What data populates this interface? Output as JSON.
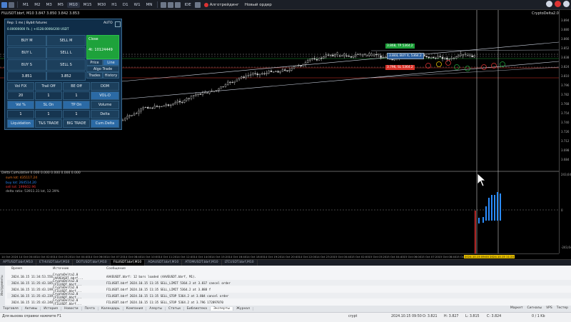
{
  "toolbar": {
    "symbol": "FILUSDT.bbrf",
    "timeframes": [
      "M1",
      "M2",
      "M3",
      "M5",
      "M10",
      "M15",
      "M30",
      "H1",
      "D1",
      "W1",
      "MN"
    ],
    "active_timeframe": "M10",
    "algo_label": "Алготрейдинг",
    "new_order_label": "Новый ордер",
    "ide_label": "IDE"
  },
  "chart": {
    "symbol_label": "FILUSDT.bbrf, M10  3.847 3.850 3.842 3.853",
    "indicator_name": "CryptoDelta2.0",
    "price_ticks": [
      "3.894",
      "3.880",
      "3.866",
      "3.852",
      "3.838",
      "3.824",
      "3.810",
      "3.796",
      "3.782",
      "3.768",
      "3.754",
      "3.740",
      "3.726",
      "3.712",
      "3.698",
      "3.684"
    ],
    "lower_ticks": [
      "243,649",
      "0",
      "-243,649"
    ],
    "order_labels": {
      "tp": "3.868, TP 5364.2",
      "entry": "3.844, BUY lt, 5364.2",
      "sl": "3.796, SL 5364.2"
    },
    "time_ticks": [
      "14 Oct 2024",
      "14 Oct 00:40",
      "14 Oct 02:00",
      "14 Oct 03:20",
      "14 Oct 04:40",
      "14 Oct 06:00",
      "14 Oct 07:20",
      "14 Oct 08:40",
      "14 Oct 10:00",
      "14 Oct 11:20",
      "14 Oct 12:40",
      "14 Oct 14:00",
      "14 Oct 15:20",
      "14 Oct 16:40",
      "14 Oct 18:00",
      "14 Oct 19:20",
      "14 Oct 20:40",
      "14 Oct 22:00",
      "14 Oct 23:20",
      "15 Oct 00:40",
      "15 Oct 02:00",
      "15 Oct 03:20",
      "15 Oct 04:40",
      "15 Oct 06:00",
      "15 Oct 07:20",
      "15 Oct 08:40",
      "15 Oct 10:00"
    ],
    "time_highlight": "2024.10.15 09:00  2024.10.15 11:20"
  },
  "panel": {
    "header": "Rep: 1 ms | Bybit futures",
    "subheader": "0.00000000 Fk. | +4128.00064200 USDT",
    "auto_label": "AUTO",
    "buy_m": "BUY M",
    "sell_m": "SELL M",
    "buy_l": "BUY L",
    "sell_l": "SELL L",
    "buy_s": "BUY S",
    "sell_s": "SELL S",
    "bid": "3.851",
    "ask": "3.852",
    "close_label": "Close",
    "close_value": "4t: 10124449",
    "price": "Price",
    "line": "Line",
    "algo_trade": "Algo Trade",
    "trades": "Trades",
    "history": "History",
    "vol_fix": "Vol FIX",
    "trail_off": "Trail Off",
    "be_off": "BE Off",
    "dom": "DOM",
    "val_20": "20",
    "val_1a": "1",
    "val_1b": "1",
    "vol_d": "VOL-D",
    "vol_pct": "Vol %",
    "sl_on": "SL On",
    "tp_on": "TP On",
    "volume": "Volume",
    "val_1c": "1",
    "val_1d": "1",
    "val_1e": "1",
    "delta": "Delta",
    "liquidation": "Liquidation",
    "ts_trade": "T&S TRADE",
    "big_trade": "BIG TRADE",
    "cum_delta": "Cum.Delta"
  },
  "indicator": {
    "title": "Delta Cumulative 0.000 0.000 0.000 0.000 0.000",
    "sum_lot": "sum lot: 435117.24",
    "buy_lot": "buy lot: 264514.20",
    "sell_lot": "sell lot: 199602.96",
    "delta_ratio": "delta ratio: 53911.31 lot, 12.39%"
  },
  "symbol_tabs": [
    "APTUSDT.bbrf,M10",
    "ETHUSDT.bbrf,M10",
    "DOTUSDT.bbrf,M10",
    "FILUSDT.bbrf,M10",
    "ADAUSDT.bbrf,M10",
    "ATOMUSDT.bbrf,M10",
    "LTCUSDT.bbrf,M10"
  ],
  "active_symbol_tab": "FILUSDT.bbrf,M10",
  "log": {
    "columns": [
      "Время",
      "Источник",
      "Сообщение"
    ],
    "side_label": "Инструменты",
    "rows": [
      {
        "time": "2024.10.15 11:34:53.556",
        "src": "CryptoDelta2.0 (AAVEUSDT.bbrf...",
        "msg": "AAVEUSDT.bbrf: 12 bars loaded (AAVEUSDT.bbrf, M1)."
      },
      {
        "time": "2024.10.15 11:35:43.185",
        "src": "CryptoDelta2.0 (FILUSDT.bbrf...",
        "msg": "FILUSDT.bbrf 2024.10.15 11:35 SELL_LIMIT 5364.2 at 3.837 cancel order"
      },
      {
        "time": "2024.10.15 11:35:43.199",
        "src": "CryptoDelta2.0 (FILUSDT.bbrf...",
        "msg": "FILUSDT.bbrf 2024.10.15 11:35 SELL_LIMIT 5364.2 at 3.888 f"
      },
      {
        "time": "2024.10.15 11:35:43.239",
        "src": "CryptoDelta2.0 (FILUSDT.bbrf...",
        "msg": "FILUSDT.bbrf 2024.10.15 11:35 SELL_STOP 5364.2 at 3.804 cancel order"
      },
      {
        "time": "2024.10.15 11:35:43.248",
        "src": "CryptoDelta2.0 (FILUSDT.bbrf...",
        "msg": "FILUSDT.bbrf 2024.10.15 11:35 SELL_STOP 5364.2 at 3.796 172897870"
      }
    ],
    "tabs": [
      "Торговля",
      "Активы",
      "История",
      "Новости",
      "Почта",
      "Календарь",
      "Компания",
      "Алерты",
      "Статьи",
      "Библиотека",
      "Эксперты",
      "Журнал"
    ],
    "active_tab": "Эксперты",
    "right_items": [
      "Маркет",
      "Сигналы",
      "VPS",
      "Тестер"
    ]
  },
  "status": {
    "help": "Для вызова справки нажмите F1",
    "profile": "crypt",
    "datetime": "2024.10.15 09:50",
    "open": "O: 3.821",
    "high": "H: 3.827",
    "low": "L: 3.815",
    "close": "C: 3.824",
    "traffic": "0 / 1 Kb"
  },
  "colors": {
    "buy_green": "#1ea23b",
    "sell_red": "#d9342b",
    "panel_bg": "#0f2d48",
    "entry_blue": "#2b5f9e"
  }
}
